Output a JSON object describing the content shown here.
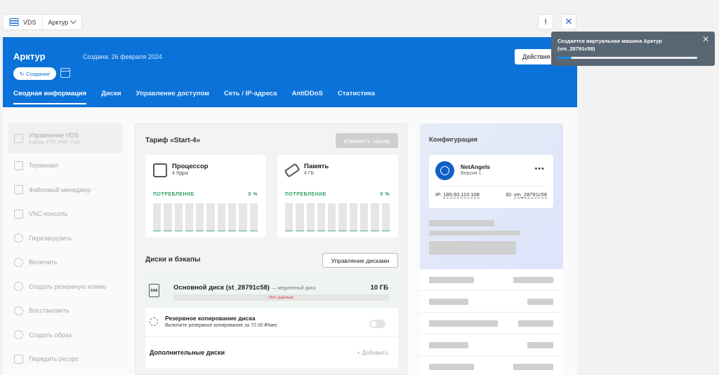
{
  "breadcrumb": {
    "service": "VDS",
    "server": "Арктур"
  },
  "header": {
    "title": "Арктур",
    "created": "Создана: 26 февраля 2024",
    "status": "Создание",
    "actions_label": "Действия",
    "tabs": [
      "Сводная информация",
      "Диски",
      "Управление доступом",
      "Сеть / IP-адреса",
      "AntiDDoS",
      "Статистика"
    ]
  },
  "sidebar": {
    "items": [
      {
        "label": "Управление VDS",
        "sub": "Сайты, FTP, PHP, Cron"
      },
      {
        "label": "Терминал"
      },
      {
        "label": "Файловый менеджер"
      },
      {
        "label": "VNC-консоль"
      },
      {
        "label": "Перезагрузить"
      },
      {
        "label": "Включить"
      },
      {
        "label": "Создать резервную копию"
      },
      {
        "label": "Восстановить"
      },
      {
        "label": "Создать образ"
      },
      {
        "label": "Передать ресурс"
      }
    ]
  },
  "tariff": {
    "title": "Тариф «Start-4»",
    "change_label": "Изменить тариф",
    "cpu": {
      "name": "Процессор",
      "sub": "4 Ядра",
      "usage_label": "ПОТРЕБЛЕНИЕ",
      "usage_value": "0 %"
    },
    "ram": {
      "name": "Память",
      "sub": "4 ГБ",
      "usage_label": "ПОТРЕБЛЕНИЕ",
      "usage_value": "0 %"
    }
  },
  "disks": {
    "title": "Диски и бэкапы",
    "manage_label": "Управление дисками",
    "main_disk": {
      "badge": "SAS",
      "name": "Основной диск (st_28791c58)",
      "type": "— медленный диск",
      "size": "10 ГБ",
      "status": "Нет данных"
    },
    "backup": {
      "title": "Резервное копирование диска",
      "sub": "Включите резервное копирование за 72.00 ₽/мес",
      "enabled": false
    },
    "extra_title": "Дополнительные диски",
    "add_label": "+ Добавить"
  },
  "config": {
    "title": "Конфигурация",
    "os_name": "NetAngels",
    "os_version": "Версия 1",
    "ip_label": "IP:",
    "ip": "185.93.110.108",
    "id_label": "ID:",
    "vm_id": "vm_28791c58"
  },
  "toast": {
    "text": "Создается виртуальная машина Арктур (vm_28791c58)",
    "progress": 0.1
  },
  "colors": {
    "brand": "#0a72d8",
    "usage": "#2e9e63",
    "toast_bg": "#586673"
  }
}
